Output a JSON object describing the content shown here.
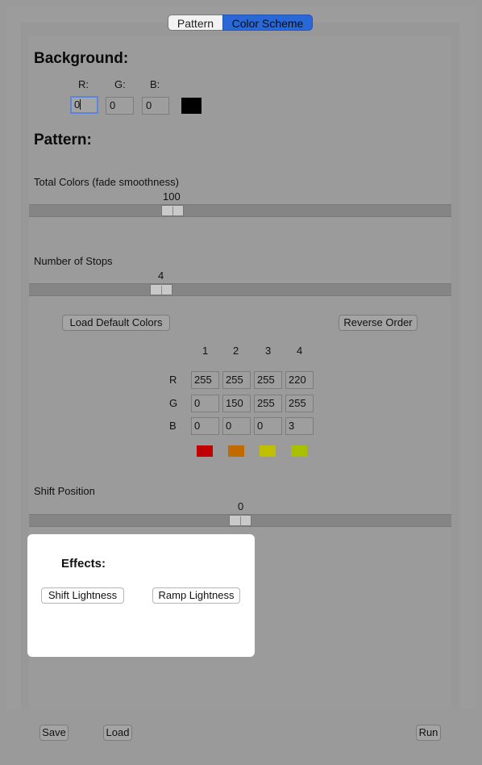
{
  "tabs": [
    {
      "label": "Pattern",
      "active": false
    },
    {
      "label": "Color Scheme",
      "active": true
    }
  ],
  "background": {
    "heading": "Background:",
    "labels": {
      "r": "R:",
      "g": "G:",
      "b": "B:"
    },
    "values": {
      "r": "0",
      "g": "0",
      "b": "0"
    },
    "swatch_color": "#000000"
  },
  "pattern": {
    "heading": "Pattern:",
    "total_colors": {
      "label": "Total Colors (fade smoothness)",
      "value": "100"
    },
    "stops": {
      "label": "Number of Stops",
      "value": "4"
    },
    "load_default_label": "Load Default Colors",
    "reverse_label": "Reverse Order",
    "columns": [
      "1",
      "2",
      "3",
      "4"
    ],
    "row_labels": [
      "R",
      "G",
      "B"
    ],
    "rows": [
      [
        "255",
        "255",
        "255",
        "220"
      ],
      [
        "0",
        "150",
        "255",
        "255"
      ],
      [
        "0",
        "0",
        "0",
        "3"
      ]
    ],
    "swatch_colors": [
      "#c00000",
      "#c06a00",
      "#c0c000",
      "#a8c000"
    ],
    "shift": {
      "label": "Shift Position",
      "value": "0"
    }
  },
  "effects": {
    "heading": "Effects:",
    "shift_lightness_label": "Shift Lightness",
    "ramp_lightness_label": "Ramp Lightness"
  },
  "footer": {
    "save_label": "Save",
    "load_label": "Load",
    "run_label": "Run"
  },
  "colors": {
    "accent": "#2a68d8",
    "panel_bg": "#9b9b9b"
  }
}
